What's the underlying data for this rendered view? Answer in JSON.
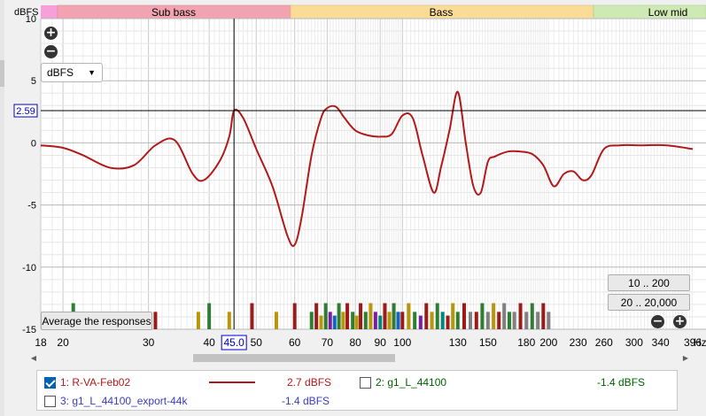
{
  "colors": {
    "sub_bass": "#f2a3b2",
    "bass": "#fadc96",
    "low_mid": "#cfe9b4",
    "left_pink": "#f69fd9",
    "curve": "#b11a1a",
    "cursor_label": "#0000c8",
    "series2": "#006400",
    "series3": "#3b3bbf"
  },
  "header": {
    "y_unit": "dBFS",
    "bands": [
      {
        "label": "Sub bass"
      },
      {
        "label": "Bass"
      },
      {
        "label": "Low mid"
      }
    ]
  },
  "controls": {
    "zoom_in_icon": "plus-circle-icon",
    "zoom_out_icon": "minus-circle-icon",
    "unit_select": "dBFS",
    "dropdown_icon": "chevron-down-icon",
    "average_label": "Average the responses",
    "range_buttons": [
      "10 .. 200",
      "20 .. 20,000"
    ],
    "hz_unit": "Hz"
  },
  "cursor": {
    "x_label": "45.0",
    "y_label": "2.59",
    "x_value": 45.0,
    "y_value": 2.59
  },
  "chart_data": {
    "type": "line",
    "x_scale": "log",
    "xlim": [
      18,
      396
    ],
    "ylim": [
      -15,
      10
    ],
    "x_ticks": [
      18,
      20,
      30,
      40,
      50,
      60,
      70,
      80,
      90,
      100,
      130,
      150,
      180,
      200,
      230,
      260,
      300,
      340,
      396
    ],
    "x_tick_labels": [
      "18",
      "20",
      "30",
      "40",
      "45.0",
      "50",
      "60",
      "70",
      "80",
      "90",
      "100",
      "130",
      "150",
      "180",
      "200",
      "230",
      "260",
      "300",
      "340",
      "396"
    ],
    "y_ticks": [
      10,
      5,
      0,
      -5,
      -10,
      -15
    ],
    "y_tick_labels": [
      "10",
      "5",
      "0",
      "-5",
      "-10",
      "-15"
    ],
    "grid": true,
    "series": [
      {
        "name": "1: R-VA-Feb02",
        "x": [
          18,
          20,
          22,
          25,
          28,
          31,
          34,
          37,
          39,
          42,
          44,
          45,
          47,
          50,
          54,
          58,
          60,
          62,
          65,
          68,
          70,
          73,
          76,
          80,
          85,
          90,
          95,
          100,
          105,
          110,
          116,
          120,
          125,
          130,
          135,
          140,
          145,
          150,
          155,
          165,
          175,
          185,
          195,
          205,
          215,
          225,
          235,
          245,
          260,
          280,
          310,
          350,
          396
        ],
        "y": [
          -0.2,
          -0.4,
          -1.0,
          -2.0,
          -1.8,
          -0.2,
          0.2,
          -2.5,
          -3.0,
          -1.5,
          0.5,
          2.59,
          2.0,
          -0.5,
          -3.5,
          -7.5,
          -8.2,
          -6.0,
          -1.0,
          2.0,
          2.8,
          2.9,
          2.0,
          1.0,
          0.6,
          0.5,
          0.7,
          2.2,
          2.0,
          -1.0,
          -4.0,
          -2.0,
          1.0,
          4.1,
          0.0,
          -3.5,
          -4.0,
          -1.5,
          -1.1,
          -0.7,
          -0.7,
          -0.9,
          -1.8,
          -3.5,
          -2.5,
          -2.3,
          -3.0,
          -2.6,
          -0.5,
          -0.2,
          -0.2,
          -0.2,
          -0.5
        ]
      }
    ],
    "peaks": {
      "x": [
        20.5,
        21.0,
        22.0,
        31.0,
        38.0,
        40.0,
        44.0,
        49.0,
        55.0,
        60.0,
        65.0,
        66.5,
        68.0,
        69.5,
        71.0,
        72.5,
        74.0,
        75.5,
        77.0,
        79.0,
        80.5,
        82.0,
        84.0,
        86.0,
        88.0,
        90.0,
        92.0,
        94.0,
        96.0,
        98.0,
        100.0,
        103.0,
        106.0,
        109.0,
        112.0,
        115.0,
        118.0,
        121.0,
        124.0,
        127.0,
        130.0,
        134.0,
        138.0,
        142.0,
        146.0,
        150.0,
        154.0,
        158.0,
        162.0,
        166.0,
        170.0,
        175.0,
        180.0,
        185.0,
        190.0,
        195.0,
        200.0
      ],
      "level": [
        -13.6,
        -12.9,
        -13.9,
        -13.6,
        -13.6,
        -12.9,
        -13.6,
        -12.9,
        -13.6,
        -12.9,
        -13.6,
        -12.9,
        -13.9,
        -12.9,
        -13.6,
        -13.9,
        -12.9,
        -13.6,
        -12.9,
        -13.6,
        -13.9,
        -12.9,
        -13.6,
        -12.9,
        -13.6,
        -13.9,
        -12.9,
        -13.6,
        -12.9,
        -13.6,
        -13.6,
        -12.9,
        -13.6,
        -13.9,
        -12.9,
        -13.6,
        -12.9,
        -13.6,
        -13.9,
        -12.9,
        -13.6,
        -12.9,
        -13.6,
        -13.6,
        -12.9,
        -13.6,
        -12.9,
        -13.6,
        -12.9,
        -13.6,
        -13.6,
        -12.9,
        -13.6,
        -12.9,
        -13.6,
        -12.9,
        -13.6
      ],
      "colors": [
        "#2e7d32",
        "#2e7d32",
        "#b8960a",
        "#9b1b1b",
        "#b8960a",
        "#2e7d32",
        "#b8960a",
        "#9b1b1b",
        "#b8960a",
        "#9b1b1b",
        "#2e7d32",
        "#9b1b1b",
        "#b8960a",
        "#2e7d32",
        "#7b1fa2",
        "#1565c0",
        "#2e7d32",
        "#b8960a",
        "#9b1b1b",
        "#2e7d32",
        "#b8960a",
        "#9b1b1b",
        "#2e7d32",
        "#b8960a",
        "#7b1fa2",
        "#00897b",
        "#9b1b1b",
        "#b8960a",
        "#2e7d32",
        "#1565c0",
        "#9b1b1b",
        "#b8960a",
        "#2e7d32",
        "#7b1fa2",
        "#9b1b1b",
        "#b8960a",
        "#2e7d32",
        "#00897b",
        "#9b1b1b",
        "#b8960a",
        "#2e7d32",
        "#9b1b1b",
        "#808080",
        "#9b1b1b",
        "#2e7d32",
        "#808080",
        "#b8960a",
        "#9b1b1b",
        "#808080",
        "#2e7d32",
        "#808080",
        "#9b1b1b",
        "#808080",
        "#2e7d32",
        "#808080",
        "#9b1b1b",
        "#808080"
      ]
    }
  },
  "legend": {
    "items": [
      {
        "label": "1: R-VA-Feb02",
        "value": "2.7 dBFS",
        "checked": true
      },
      {
        "label": "2: g1_L_44100",
        "value": "-1.4 dBFS",
        "checked": false
      },
      {
        "label": "3: g1_L_44100_export-44k",
        "value": "-1.4 dBFS",
        "checked": false
      }
    ]
  }
}
